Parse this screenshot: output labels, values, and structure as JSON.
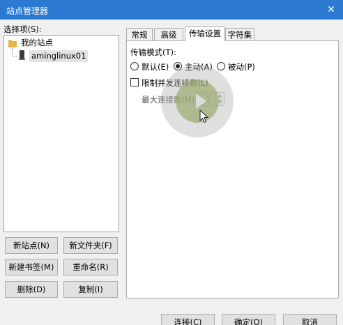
{
  "window": {
    "title": "站点管理器",
    "close_glyph": "✕"
  },
  "sites": {
    "label": "选择项(S):",
    "tree": [
      {
        "label": "我的站点",
        "icon": "folder-icon"
      },
      {
        "label": "aminglinux01",
        "icon": "server-icon"
      }
    ],
    "buttons": {
      "new_site": "新站点(N)",
      "new_folder": "新文件夹(F)",
      "new_bookmark": "新建书签(M)",
      "rename": "重命名(R)",
      "delete": "删除(D)",
      "copy": "复制(I)"
    }
  },
  "tabs": [
    "常规",
    "高级",
    "传输设置",
    "字符集"
  ],
  "active_tab": "传输设置",
  "transfer": {
    "mode_label": "传输模式(T):",
    "modes": [
      {
        "label": "默认(E)",
        "checked": false
      },
      {
        "label": "主动(A)",
        "checked": true
      },
      {
        "label": "被动(P)",
        "checked": false
      }
    ],
    "limit_label": "限制并发连接数(L)",
    "limit_checked": false,
    "max_conn_label": "最大连接数(M):",
    "max_conn_value": "1"
  },
  "footer": {
    "connect": "连接(C)",
    "ok": "确定(O)",
    "cancel": "取消"
  }
}
